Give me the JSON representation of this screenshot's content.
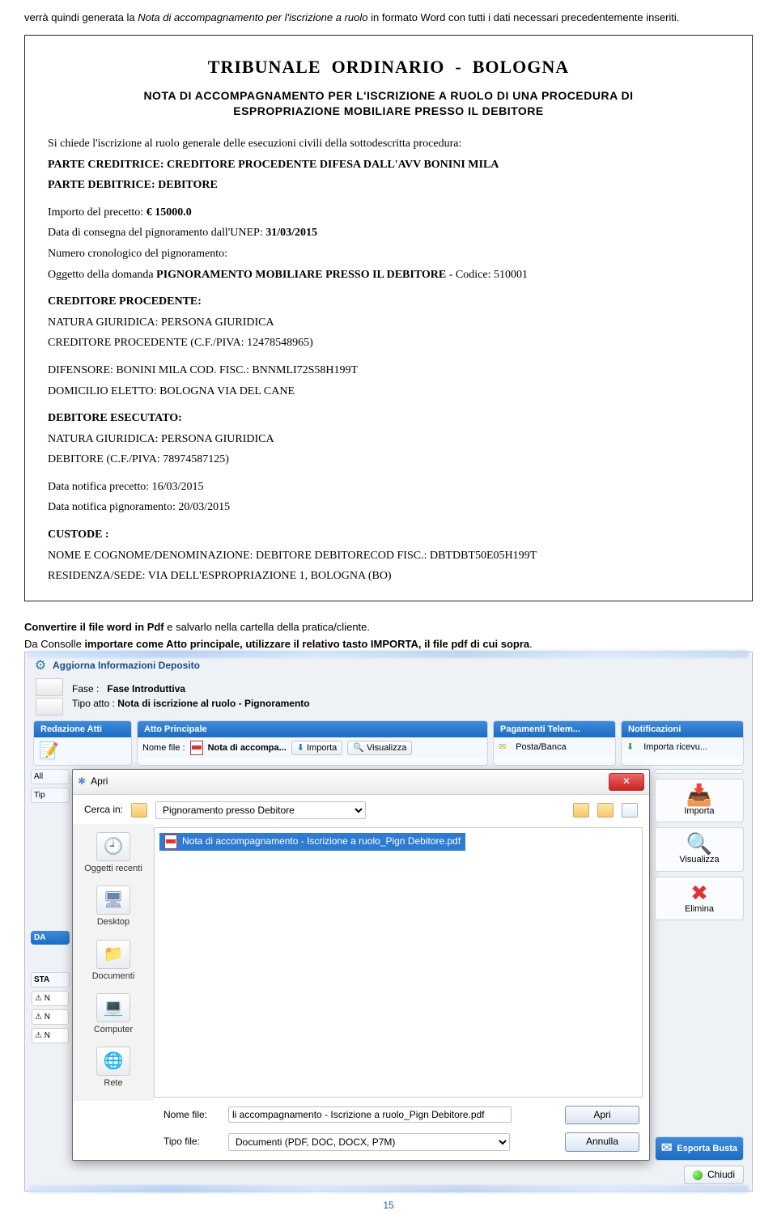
{
  "intro": {
    "pre": "verrà quindi generata la ",
    "italic": "Nota di accompagnamento per l'iscrizione a ruolo",
    "post": " in formato Word con tutti i dati necessari precedentemente inseriti."
  },
  "doc": {
    "tribunale": "TRIBUNALE  ORDINARIO  -  BOLOGNA",
    "nota_l1": "NOTA DI ACCOMPAGNAMENTO PER L'ISCRIZIONE A RUOLO DI UNA PROCEDURA DI",
    "nota_l2": "ESPROPRIAZIONE MOBILIARE PRESSO IL DEBITORE",
    "p1": "Si chiede l'iscrizione al ruolo generale delle esecuzioni civili della sottodescritta procedura:",
    "p2": "PARTE CREDITRICE: CREDITORE PROCEDENTE  DIFESA DALL'AVV BONINI MILA",
    "p3": "PARTE DEBITRICE: DEBITORE",
    "p4_a": "Importo del precetto:  ",
    "p4_b": "€ 15000.0",
    "p5_a": "Data di consegna del pignoramento  dall'UNEP: ",
    "p5_b": "31/03/2015",
    "p6": "Numero cronologico  del pignoramento:",
    "p7_a": "Oggetto della domanda ",
    "p7_b": "PIGNORAMENTO MOBILIARE PRESSO IL DEBITORE",
    "p7_c": " - Codice:  510001",
    "p8": "CREDITORE PROCEDENTE:",
    "p9": "NATURA GIURIDICA: PERSONA GIURIDICA",
    "p10": "CREDITORE PROCEDENTE (C.F./PIVA: 12478548965)",
    "p11": "DIFENSORE: BONINI MILA COD. FISC.: BNNMLI72S58H199T",
    "p12": "DOMICILIO ELETTO:  BOLOGNA VIA DEL CANE",
    "p13": "DEBITORE ESECUTATO:",
    "p14": "NATURA GIURIDICA: PERSONA GIURIDICA",
    "p15": "DEBITORE (C.F./PIVA: 78974587125)",
    "p16": "Data notifica precetto:  16/03/2015",
    "p17": "Data notifica pignoramento:  20/03/2015",
    "p18": "CUSTODE :",
    "p19": "NOME E COGNOME/DENOMINAZIONE: DEBITORE DEBITORECOD FISC.: DBTDBT50E05H199T",
    "p20": "RESIDENZA/SEDE: VIA DELL'ESPROPRIAZIONE 1, BOLOGNA (BO)"
  },
  "instr2": {
    "a1": "Convertire il file word in Pdf",
    "a2": " e salvarlo nella cartella della pratica/cliente.",
    "b1": "Da Consolle ",
    "b2": "importare come Atto principale, utilizzare il relativo tasto IMPORTA, il file pdf di cui sopra",
    "b3": "."
  },
  "app": {
    "aggiorna": "Aggiorna Informazioni Deposito",
    "fase_lbl": "Fase :",
    "fase_val": "Fase Introduttiva",
    "tipo_atto_lbl": "Tipo atto :",
    "tipo_atto_val": "Nota di iscrizione al ruolo - Pignoramento",
    "panels": {
      "redazione": "Redazione Atti",
      "atto": {
        "hd": "Atto Principale",
        "nome_lbl": "Nome file :",
        "nome_val": "Nota di accompa...",
        "importa": "Importa",
        "visualizza": "Visualizza"
      },
      "pagam": {
        "hd": "Pagamenti Telem...",
        "posta": "Posta/Banca"
      },
      "notif": {
        "hd": "Notificazioni",
        "importa_ricevu": "Importa ricevu..."
      }
    },
    "left": {
      "all": "All",
      "tip": "Tip",
      "da": "DA",
      "sta": "STA",
      "n": "N"
    },
    "rightbar": {
      "importa": "Importa",
      "visualizza": "Visualizza",
      "elimina": "Elimina",
      "esporta": "Esporta Busta"
    },
    "chiudi": "Chiudi"
  },
  "dialog": {
    "title": "Apri",
    "cerca_lbl": "Cerca in:",
    "cerca_val": "Pignoramento presso Debitore",
    "selected_file": "Nota di accompagnamento - Iscrizione a ruolo_Pign Debitore.pdf",
    "places": [
      "Oggetti recenti",
      "Desktop",
      "Documenti",
      "Computer",
      "Rete"
    ],
    "nomefile_lbl": "Nome file:",
    "nomefile_val": "li accompagnamento - Iscrizione a ruolo_Pign Debitore.pdf",
    "tipofile_lbl": "Tipo file:",
    "tipofile_val": "Documenti (PDF, DOC, DOCX, P7M)",
    "apri": "Apri",
    "annulla": "Annulla"
  },
  "pagenum": "15"
}
